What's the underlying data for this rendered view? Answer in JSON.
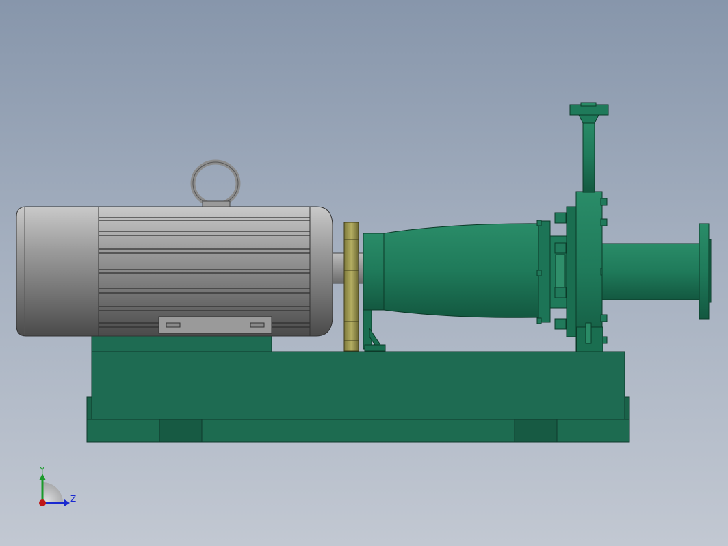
{
  "viewport": {
    "background_top": "#8796ab",
    "background_bottom": "#c2c8d2"
  },
  "model": {
    "motor_color": "#8a8a8a",
    "pump_color": "#1f7a5a",
    "base_color": "#1e6b52",
    "coupling_color": "#a8a25a"
  },
  "triad": {
    "y_label": "Y",
    "z_label": "Z",
    "y_color": "#1a9a2a",
    "z_color": "#1a2ad0",
    "x_color": "#c01818"
  }
}
